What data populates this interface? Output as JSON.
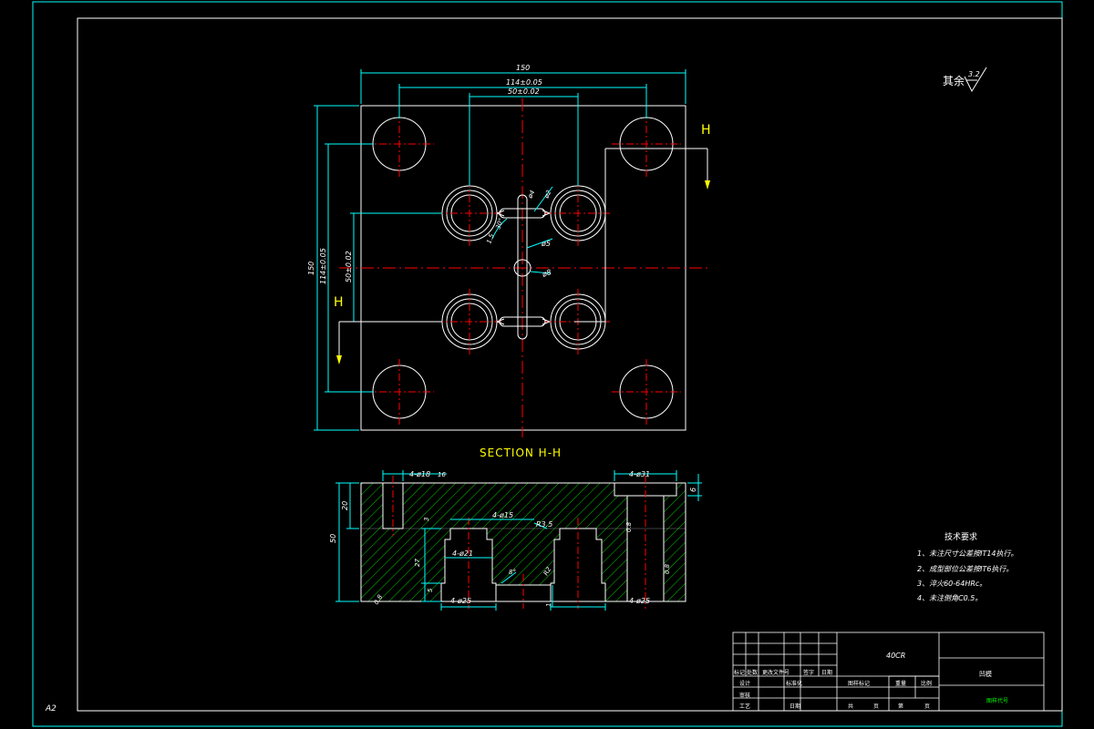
{
  "sheet": {
    "size_label": "A2"
  },
  "roughness": {
    "prefix": "其余",
    "value": "3.2"
  },
  "plan_view": {
    "dims": {
      "width_total": "150",
      "width_mid": "114±0.05",
      "width_inner": "50±0.02",
      "height_total": "150",
      "height_mid": "114±0.05",
      "height_inner": "50±0.02",
      "small_dia": "ø4",
      "small_dia2": "ø2",
      "runner_dia": "ø5",
      "sprue_dia": "ø8",
      "angle": "30°",
      "depth": "1.5"
    },
    "section_letter_left": "H",
    "section_letter_right": "H"
  },
  "section_view": {
    "title": "SECTION  H-H",
    "dims": {
      "pin_holes": "4-ø18",
      "pin_holes_r": "16",
      "counterbore": "4-ø31",
      "counterbore_depth": "6",
      "height_total": "50",
      "height_top": "20",
      "cavity_top": "4-ø15",
      "cavity_mid": "4-ø21",
      "cavity_bottom_left": "4-ø25",
      "cavity_bottom_right": "4-ø25",
      "cav_r": "R3.5",
      "sprue_ang": "8°",
      "sprue_r": "R2",
      "depth_27": "27",
      "depth_5": "5",
      "depth_3": "3",
      "depth_1": "1",
      "finish_a": "0.8",
      "finish_b": "0.8",
      "finish_c": "0.8"
    }
  },
  "tech_requirements": {
    "title": "技术要求",
    "items": [
      "1、未注尺寸公差按IT14执行。",
      "2、成型部位公差按IT6执行。",
      "3、淬火60-64HRc。",
      "4、未注倒角C0.5。"
    ]
  },
  "title_block": {
    "material": "40CR",
    "part_name": "凹模",
    "drawing_no": "图样代号",
    "row_headers": [
      "标记",
      "处数",
      "更改文件号",
      "签字",
      "日期"
    ],
    "designer_label": "设计",
    "standard_label": "标准化",
    "check_label": "审核",
    "process_label": "工艺",
    "date_label": "日期",
    "stage_label": "图样标记",
    "weight_label": "重量",
    "scale_label": "比例",
    "sheets_label": "共",
    "sheets_unit": "页",
    "sheet_label": "第",
    "sheet_unit": "页"
  },
  "colors": {
    "frame": "#00ffff",
    "outline": "#ffffff",
    "center": "#ff0000",
    "dim": "#00ffff",
    "hatch": "#00c800",
    "section_title": "#ffff00",
    "text": "#ffffff",
    "green_text": "#00ff00"
  }
}
